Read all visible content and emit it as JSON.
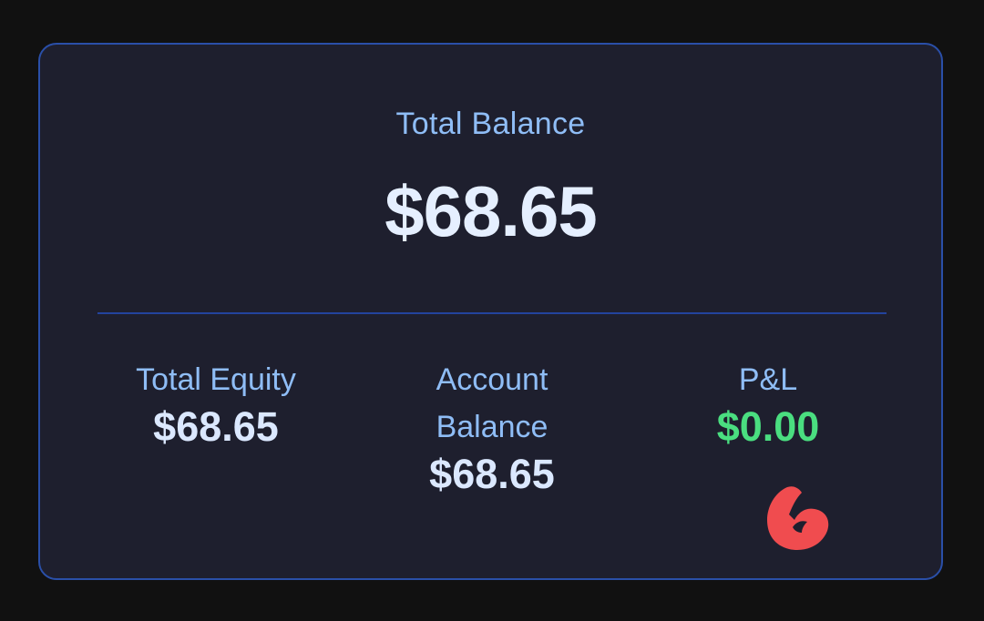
{
  "summary": {
    "total_balance_label": "Total Balance",
    "total_balance_value": "$68.65"
  },
  "stats": {
    "total_equity": {
      "label": "Total Equity",
      "value": "$68.65"
    },
    "account_balance": {
      "label": "Account Balance",
      "value": "$68.65"
    },
    "pnl": {
      "label": "P&L",
      "value": "$0.00"
    }
  },
  "colors": {
    "background": "#111111",
    "card": "#1e1f2e",
    "card_border": "#2a4fa8",
    "label": "#8fbdf6",
    "value": "#e5efff",
    "positive": "#4ade80",
    "annotation": "#f04c4f"
  },
  "annotation": {
    "icon": "red-scribble-mark"
  }
}
